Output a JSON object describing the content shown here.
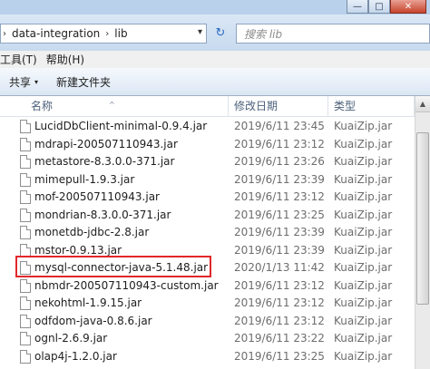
{
  "window": {
    "minimize": "—",
    "maximize": "□",
    "close": "✕"
  },
  "address": {
    "crumbs": [
      "data-integration",
      "lib"
    ],
    "sep": "›",
    "dropdown": "▾",
    "refresh": "↻",
    "search_placeholder": "搜索 lib"
  },
  "menu": {
    "items": [
      "工具(T)",
      "帮助(H)"
    ]
  },
  "toolbar": {
    "share": "共享",
    "share_dd": "▾",
    "new_folder": "新建文件夹"
  },
  "columns": {
    "name": "名称",
    "date": "修改日期",
    "type": "类型",
    "sort_arrow": "^"
  },
  "files": [
    {
      "name": "LucidDbClient-minimal-0.9.4.jar",
      "date": "2019/6/11 23:45",
      "type": "KuaiZip.jar"
    },
    {
      "name": "mdrapi-200507110943.jar",
      "date": "2019/6/11 23:12",
      "type": "KuaiZip.jar"
    },
    {
      "name": "metastore-8.3.0.0-371.jar",
      "date": "2019/6/11 23:26",
      "type": "KuaiZip.jar"
    },
    {
      "name": "mimepull-1.9.3.jar",
      "date": "2019/6/11 23:39",
      "type": "KuaiZip.jar"
    },
    {
      "name": "mof-200507110943.jar",
      "date": "2019/6/11 23:12",
      "type": "KuaiZip.jar"
    },
    {
      "name": "mondrian-8.3.0.0-371.jar",
      "date": "2019/6/11 23:25",
      "type": "KuaiZip.jar"
    },
    {
      "name": "monetdb-jdbc-2.8.jar",
      "date": "2019/6/11 23:39",
      "type": "KuaiZip.jar"
    },
    {
      "name": "mstor-0.9.13.jar",
      "date": "2019/6/11 23:39",
      "type": "KuaiZip.jar"
    },
    {
      "name": "mysql-connector-java-5.1.48.jar",
      "date": "2020/1/13 11:42",
      "type": "KuaiZip.jar"
    },
    {
      "name": "nbmdr-200507110943-custom.jar",
      "date": "2019/6/11 23:12",
      "type": "KuaiZip.jar"
    },
    {
      "name": "nekohtml-1.9.15.jar",
      "date": "2019/6/11 23:12",
      "type": "KuaiZip.jar"
    },
    {
      "name": "odfdom-java-0.8.6.jar",
      "date": "2019/6/11 23:12",
      "type": "KuaiZip.jar"
    },
    {
      "name": "ognl-2.6.9.jar",
      "date": "2019/6/11 23:22",
      "type": "KuaiZip.jar"
    },
    {
      "name": "olap4j-1.2.0.jar",
      "date": "2019/6/11 23:25",
      "type": "KuaiZip.jar"
    }
  ]
}
